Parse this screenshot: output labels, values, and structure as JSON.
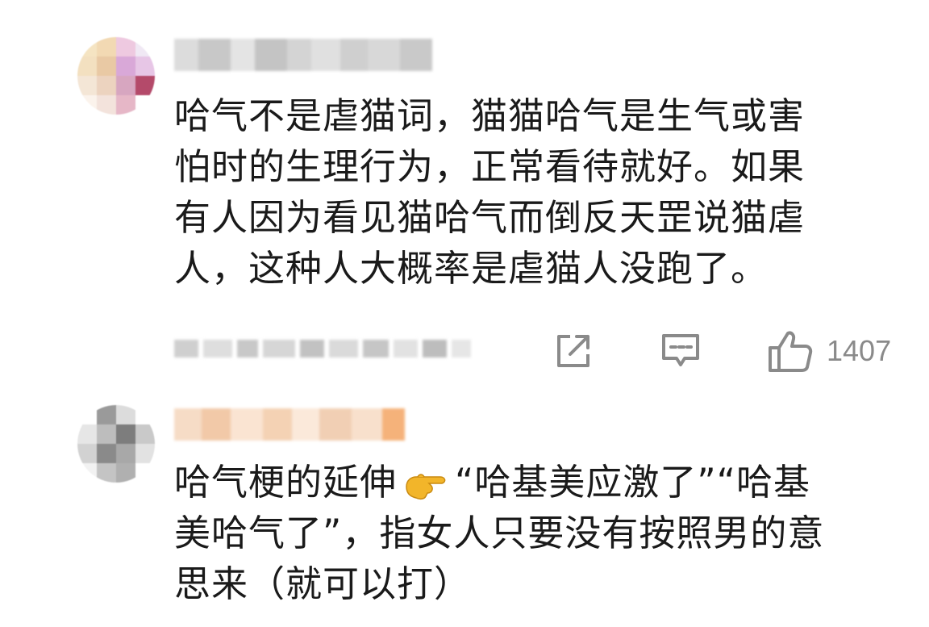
{
  "comments": [
    {
      "text": "哈气不是虐猫词，猫猫哈气是生气或害\n怕时的生理行为，正常看待就好。如果\n有人因为看见猫哈气而倒反天罡说猫虐\n人，这种人大概率是虐猫人没跑了。",
      "like_count": "1407",
      "avatar_icon": "blurred-avatar-icon",
      "actions": [
        "share-icon",
        "reply-icon",
        "like-icon"
      ]
    },
    {
      "text_before_emoji": "哈气梗的延伸",
      "emoji": "pointing-hand-emoji",
      "text_after_emoji": "“哈基美应激了”“哈基\n美哈气了”，指女人只要没有按照男的意\n思来（就可以打）",
      "avatar_icon": "blurred-avatar-icon"
    }
  ],
  "colors": {
    "icon_gray": "#8a8a8a",
    "text": "#1a1a1a",
    "background": "#ffffff"
  }
}
